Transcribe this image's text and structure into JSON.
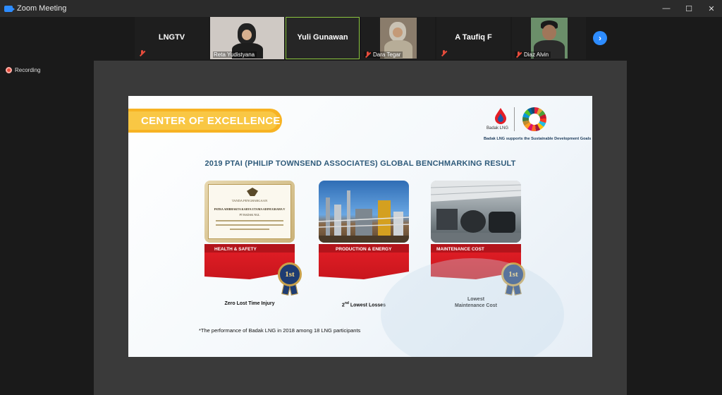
{
  "window": {
    "title": "Zoom Meeting",
    "controls": [
      "—",
      "☐",
      "✕"
    ]
  },
  "participants": [
    {
      "name": "LNGTV",
      "has_video": false,
      "muted": true,
      "display": "name"
    },
    {
      "name": "Reta Yudistyana",
      "has_video": true,
      "muted": false,
      "display": "video"
    },
    {
      "name": "Yuli Gunawan",
      "has_video": false,
      "muted": false,
      "display": "name",
      "active_speaker": true
    },
    {
      "name": "Dara Tegar",
      "has_video": true,
      "muted": true,
      "display": "video"
    },
    {
      "name": "A Taufiq F",
      "has_video": false,
      "muted": true,
      "display": "name"
    },
    {
      "name": "Diaz Alvin",
      "has_video": true,
      "muted": true,
      "display": "video"
    }
  ],
  "recording": {
    "label": "Recording"
  },
  "slide": {
    "banner_title": "CENTER OF EXCELLENCE",
    "logo_name": "Badak LNG",
    "sdg_text": "Badak LNG supports the Sustainable Development Goals",
    "title": "2019 PTAI (PHILIP TOWNSEND ASSOCIATES) GLOBAL BENCHMARKING RESULT",
    "cards": [
      {
        "label": "HEALTH & SAFETY",
        "caption": "Zero Lost Time Injury",
        "medal": "1st",
        "image": "certificate",
        "certificate": {
          "heading": "TANDA PENGHARGAAN",
          "award": "PATRA ADIBHAKTA KARYA UTAMA ADINUGRAHA V",
          "recipient": "PT BADAK NGL"
        }
      },
      {
        "label": "PRODUCTION & ENERGY",
        "caption_prefix": "2",
        "caption_sup": "nd",
        "caption": " Lowest  Losses",
        "medal": null,
        "image": "refinery"
      },
      {
        "label": "MAINTENANCE COST",
        "caption_line1": "Lowest",
        "caption_line2": "Maintenance Cost",
        "medal": "1st",
        "image": "workshop"
      }
    ],
    "footnote": "*The performance of Badak LNG in 2018 among 18 LNG participants"
  },
  "colors": {
    "accent": "#2d8cff",
    "active_speaker": "#8dc63f",
    "banner_yellow": "#f7b323",
    "card_red": "#e41e26",
    "title_blue": "#2e5a7a",
    "muted_red": "#e74c3c"
  }
}
